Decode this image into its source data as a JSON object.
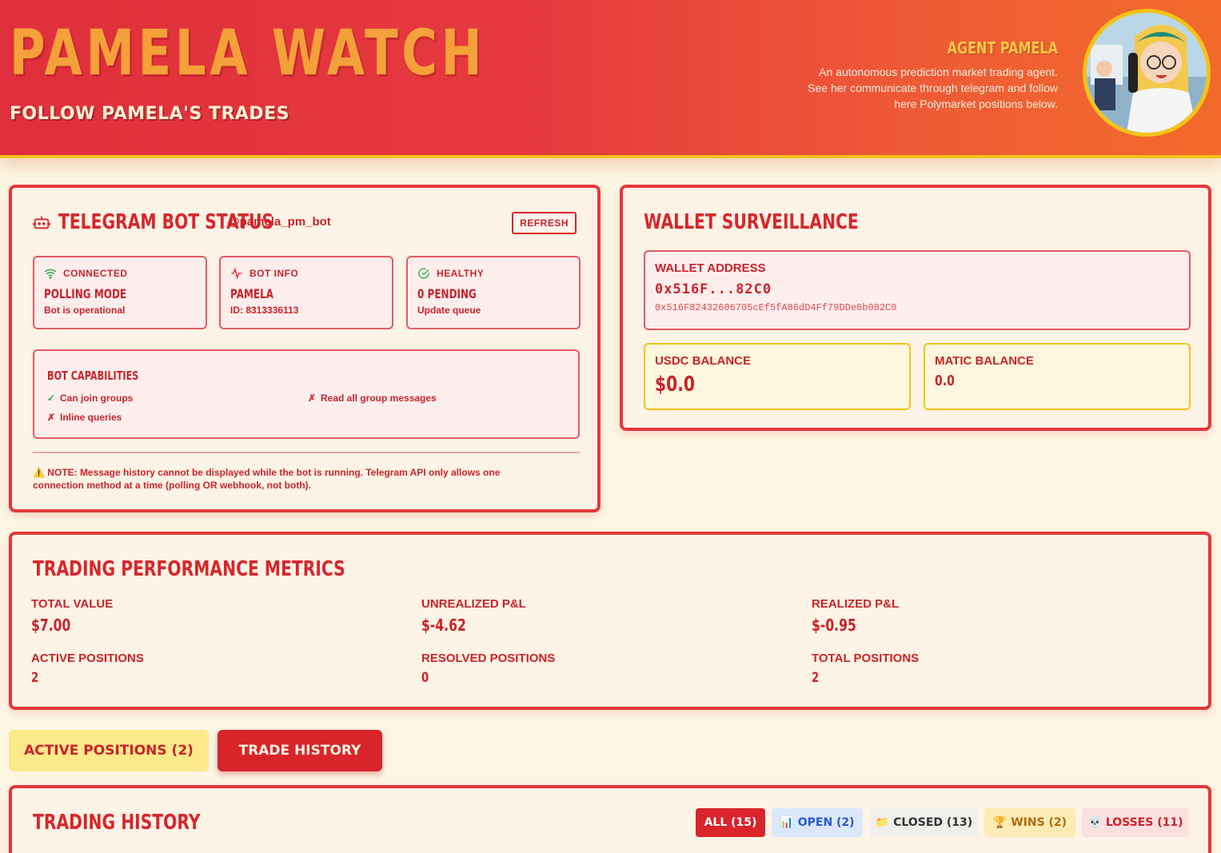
{
  "header": {
    "title": "PAMELA WATCH",
    "subtitle": "FOLLOW PAMELA'S TRADES",
    "agent_name": "AGENT PAMELA",
    "agent_desc_line1": "An autonomous prediction market trading agent.",
    "agent_desc_line2": "See her communicate through telegram and follow",
    "agent_desc_line3": "here Polymarket positions below."
  },
  "telegram": {
    "title": "TELEGRAM BOT STATUS",
    "handle": "@pamela_pm_bot",
    "refresh_label": "REFRESH",
    "stats": [
      {
        "head": "CONNECTED",
        "main": "POLLING MODE",
        "foot": "Bot is operational",
        "icon": "wifi-icon"
      },
      {
        "head": "BOT INFO",
        "main": "PAMELA",
        "foot": "ID: 8313336113",
        "icon": "activity-icon"
      },
      {
        "head": "HEALTHY",
        "main": "0 PENDING",
        "foot": "Update queue",
        "icon": "check-circle-icon"
      }
    ],
    "capabilities_title": "BOT CAPABILITIES",
    "capabilities": [
      {
        "mark": "✓",
        "label": "Can join groups",
        "enabled": true
      },
      {
        "mark": "✗",
        "label": "Read all group messages",
        "enabled": false
      },
      {
        "mark": "✗",
        "label": "Inline queries",
        "enabled": false
      }
    ],
    "note_line1": "⚠️ NOTE: Message history cannot be displayed while the bot is running. Telegram API only allows one",
    "note_line2": "connection method at a time (polling OR webhook, not both)."
  },
  "wallet": {
    "title": "WALLET SURVEILLANCE",
    "address_label": "WALLET ADDRESS",
    "address_short": "0x516F...82C0",
    "address_full": "0x516F82432606705cEf5fA86dD4Ff79DDe6b082C0",
    "usdc_label": "USDC BALANCE",
    "usdc_value": "$0.0",
    "matic_label": "MATIC BALANCE",
    "matic_value": "0.0"
  },
  "performance": {
    "title": "TRADING PERFORMANCE METRICS",
    "total_value_label": "TOTAL VALUE",
    "total_value": "$7.00",
    "unrealized_label": "UNREALIZED P&L",
    "unrealized": "$-4.62",
    "realized_label": "REALIZED P&L",
    "realized": "$-0.95",
    "active_label": "ACTIVE POSITIONS",
    "active": "2",
    "resolved_label": "RESOLVED POSITIONS",
    "resolved": "0",
    "total_positions_label": "TOTAL POSITIONS",
    "total_positions": "2"
  },
  "tabs": {
    "active_positions": "ACTIVE POSITIONS (2)",
    "trade_history": "TRADE HISTORY"
  },
  "history": {
    "title": "TRADING HISTORY",
    "filters": {
      "all": "ALL (15)",
      "open": "📊 OPEN (2)",
      "closed": "📁 CLOSED (13)",
      "wins": "🏆 WINS (2)",
      "losses": "💀 LOSSES (11)"
    }
  },
  "colors": {
    "accent": "#d7262b",
    "gold": "#f5c218",
    "background": "#fdf6e3",
    "success": "#2aa84a"
  }
}
